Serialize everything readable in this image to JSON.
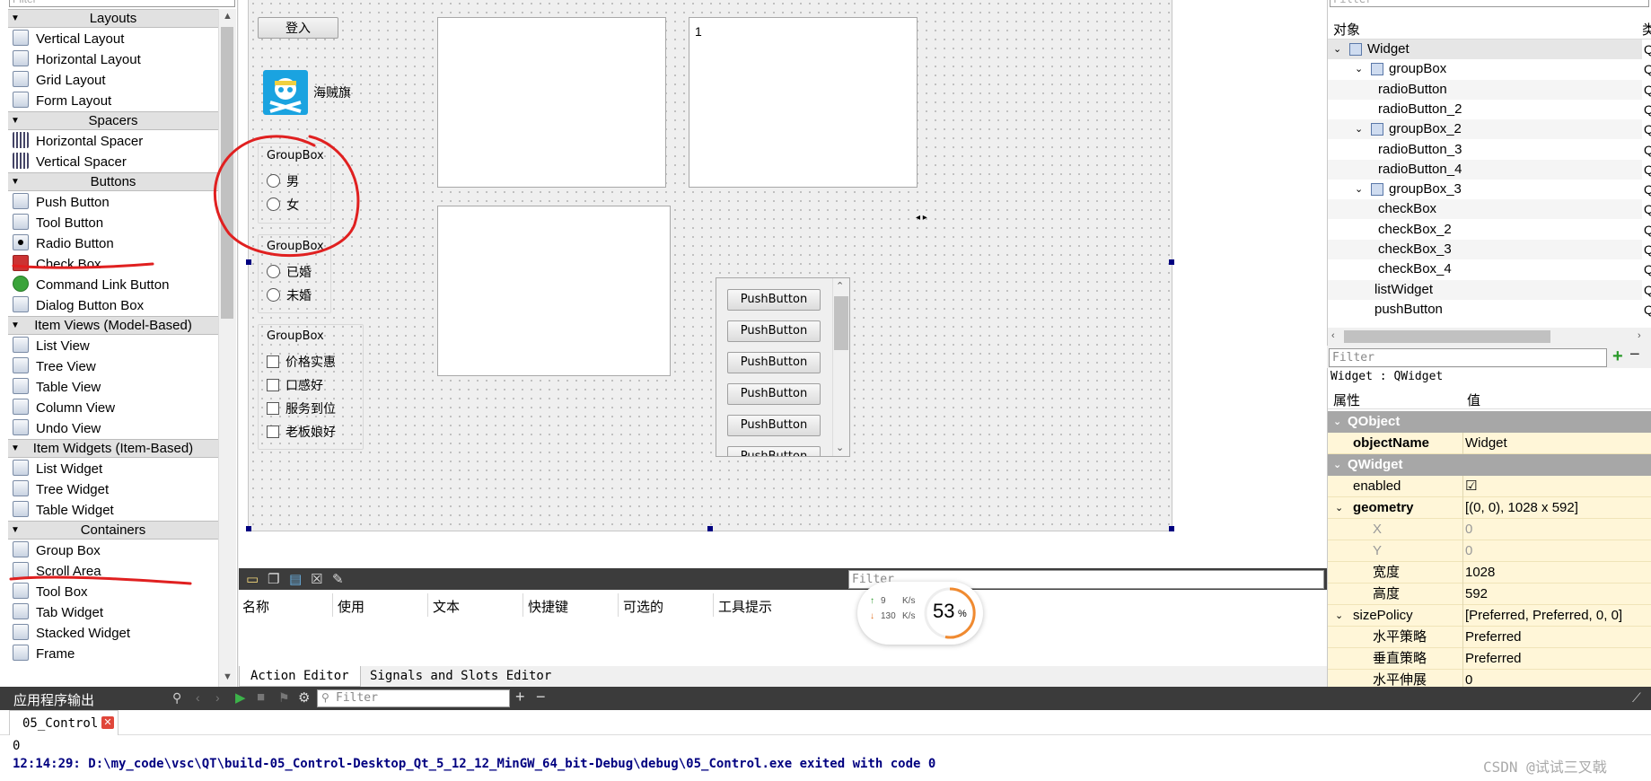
{
  "widget_box": {
    "filter_placeholder": "Filter",
    "categories": {
      "layouts": "Layouts",
      "spacers": "Spacers",
      "buttons": "Buttons",
      "item_views": "Item Views (Model-Based)",
      "item_widgets": "Item Widgets (Item-Based)",
      "containers": "Containers"
    },
    "items": {
      "vertical_layout": "Vertical Layout",
      "horizontal_layout": "Horizontal Layout",
      "grid_layout": "Grid Layout",
      "form_layout": "Form Layout",
      "horizontal_spacer": "Horizontal Spacer",
      "vertical_spacer": "Vertical Spacer",
      "push_button": "Push Button",
      "tool_button": "Tool Button",
      "radio_button": "Radio Button",
      "check_box": "Check Box",
      "command_link_button": "Command Link Button",
      "dialog_button_box": "Dialog Button Box",
      "list_view": "List View",
      "tree_view": "Tree View",
      "table_view": "Table View",
      "column_view": "Column View",
      "undo_view": "Undo View",
      "list_widget": "List Widget",
      "tree_widget": "Tree Widget",
      "table_widget": "Table Widget",
      "group_box": "Group Box",
      "scroll_area": "Scroll Area",
      "tool_box": "Tool Box",
      "tab_widget": "Tab Widget",
      "stacked_widget": "Stacked Widget",
      "frame": "Frame"
    }
  },
  "form": {
    "login_button": "登入",
    "pirate_label": "海贼旗",
    "group1": {
      "title": "GroupBox",
      "options": [
        "男",
        "女"
      ]
    },
    "group2": {
      "title": "GroupBox",
      "options": [
        "已婚",
        "未婚"
      ]
    },
    "group3": {
      "title": "GroupBox",
      "options": [
        "价格实惠",
        "口感好",
        "服务到位",
        "老板娘好"
      ]
    },
    "list_panel_text": "1",
    "scroll_buttons": [
      "PushButton",
      "PushButton",
      "PushButton",
      "PushButton",
      "PushButton",
      "PushButton"
    ]
  },
  "action_editor": {
    "filter_placeholder": "Filter",
    "columns": [
      "名称",
      "使用",
      "文本",
      "快捷键",
      "可选的",
      "工具提示"
    ],
    "tabs": [
      "Action Editor",
      "Signals and Slots Editor"
    ]
  },
  "speed_overlay": {
    "upload": "9",
    "upload_unit": "K/s",
    "download": "130",
    "download_unit": "K/s",
    "percent": "53",
    "percent_sign": "%"
  },
  "object_inspector": {
    "filter_placeholder": "Filter",
    "header_object": "对象",
    "header_class": "类",
    "tree": [
      {
        "name": "Widget",
        "cls": "Q",
        "level": 0,
        "expand": true
      },
      {
        "name": "groupBox",
        "cls": "Q",
        "level": 1,
        "expand": true
      },
      {
        "name": "radioButton",
        "cls": "Q",
        "level": 2,
        "expand": false
      },
      {
        "name": "radioButton_2",
        "cls": "Q",
        "level": 2,
        "expand": false
      },
      {
        "name": "groupBox_2",
        "cls": "Q",
        "level": 1,
        "expand": true
      },
      {
        "name": "radioButton_3",
        "cls": "Q",
        "level": 2,
        "expand": false
      },
      {
        "name": "radioButton_4",
        "cls": "Q",
        "level": 2,
        "expand": false
      },
      {
        "name": "groupBox_3",
        "cls": "Q",
        "level": 1,
        "expand": true
      },
      {
        "name": "checkBox",
        "cls": "Q",
        "level": 2,
        "expand": false
      },
      {
        "name": "checkBox_2",
        "cls": "Q",
        "level": 2,
        "expand": false
      },
      {
        "name": "checkBox_3",
        "cls": "Q",
        "level": 2,
        "expand": false
      },
      {
        "name": "checkBox_4",
        "cls": "Q",
        "level": 2,
        "expand": false
      },
      {
        "name": "listWidget",
        "cls": "Q",
        "level": 1,
        "expand": false
      },
      {
        "name": "pushButton",
        "cls": "Q",
        "level": 1,
        "expand": false
      }
    ]
  },
  "property_editor": {
    "filter_placeholder": "Filter",
    "context": "Widget : QWidget",
    "header_property": "属性",
    "header_value": "值",
    "rows": [
      {
        "kind": "section",
        "name": "QObject"
      },
      {
        "kind": "prop",
        "name": "objectName",
        "value": "Widget",
        "bold": true
      },
      {
        "kind": "section",
        "name": "QWidget"
      },
      {
        "kind": "prop",
        "name": "enabled",
        "value": "☑",
        "bold": false
      },
      {
        "kind": "prop",
        "name": "geometry",
        "value": "[(0, 0), 1028 x 592]",
        "bold": true,
        "expand": true
      },
      {
        "kind": "sub",
        "name": "X",
        "value": "0"
      },
      {
        "kind": "sub",
        "name": "Y",
        "value": "0"
      },
      {
        "kind": "sub2",
        "name": "宽度",
        "value": "1028"
      },
      {
        "kind": "sub2",
        "name": "高度",
        "value": "592"
      },
      {
        "kind": "prop",
        "name": "sizePolicy",
        "value": "[Preferred, Preferred, 0, 0]",
        "bold": false,
        "expand": true
      },
      {
        "kind": "sub2",
        "name": "水平策略",
        "value": "Preferred"
      },
      {
        "kind": "sub2",
        "name": "垂直策略",
        "value": "Preferred"
      },
      {
        "kind": "sub2",
        "name": "水平伸展",
        "value": "0"
      }
    ]
  },
  "output_pane": {
    "title": "应用程序输出",
    "filter_placeholder": "Filter",
    "tab_label": "05_Control",
    "lines": [
      "0",
      "12:14:29: D:\\my_code\\vsc\\QT\\build-05_Control-Desktop_Qt_5_12_12_MinGW_64_bit-Debug\\debug\\05_Control.exe exited with code 0"
    ],
    "watermark": "CSDN @试试三叉戟"
  },
  "colors": {
    "annotation_red": "#e02020",
    "handle_blue": "#000080",
    "section_gray": "#a7a7a7",
    "property_bg": "#fff6d8"
  }
}
